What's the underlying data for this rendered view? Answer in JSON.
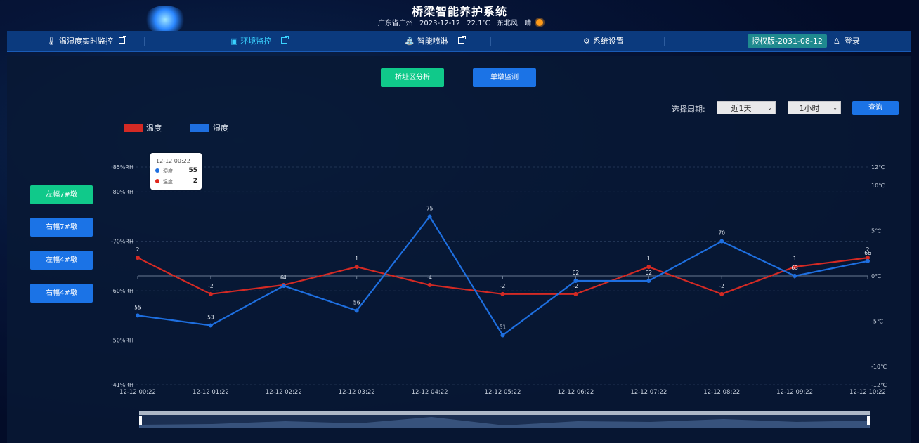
{
  "header": {
    "title": "桥梁智能养护系统",
    "location": "广东省广州",
    "date": "2023-12-12",
    "temperature": "22.1℃",
    "wind": "东北风",
    "weather": "晴",
    "weather_icon": "sun-icon"
  },
  "nav": {
    "items": [
      {
        "label": "温湿度实时监控",
        "icon": "thermometer-icon"
      },
      {
        "label": "环境监控",
        "icon": "monitor-icon",
        "active": true
      },
      {
        "label": "智能喷淋",
        "icon": "sprinkler-icon"
      },
      {
        "label": "系统设置",
        "icon": "gear-icon"
      }
    ],
    "license": "授权版-2031-08-12",
    "login": "登录"
  },
  "top_buttons": {
    "left": "桥址区分析",
    "right": "单墩监测"
  },
  "side_buttons": [
    "左幅7#墩",
    "右幅7#墩",
    "左幅4#墩",
    "右幅4#墩"
  ],
  "filter": {
    "label": "选择周期:",
    "period": "近1天",
    "interval": "1小时",
    "query": "查询"
  },
  "legend": {
    "temperature": "温度",
    "humidity": "湿度"
  },
  "tooltip": {
    "time": "12-12 00:22",
    "rows": [
      {
        "name": "湿度",
        "value": "55",
        "color": "#1e6fe0"
      },
      {
        "name": "温度",
        "value": "2",
        "color": "#e0251b"
      }
    ]
  },
  "colors": {
    "temperature": "#d42a24",
    "humidity": "#1e6fe0",
    "accent_green": "#10c98a",
    "accent_blue": "#1b73e6"
  },
  "chart_data": {
    "type": "line",
    "x": [
      "12-12 00:22",
      "12-12 01:22",
      "12-12 02:22",
      "12-12 03:22",
      "12-12 04:22",
      "12-12 05:22",
      "12-12 06:22",
      "12-12 07:22",
      "12-12 08:22",
      "12-12 09:22",
      "12-12 10:22"
    ],
    "series": [
      {
        "name": "温度",
        "axis": "right",
        "unit": "℃",
        "values": [
          2,
          -2,
          -1,
          1,
          -1,
          -2,
          -2,
          1,
          -2,
          1,
          2
        ]
      },
      {
        "name": "湿度",
        "axis": "left",
        "unit": "%RH",
        "values": [
          55,
          53,
          61,
          56,
          75,
          51,
          62,
          62,
          70,
          63,
          66
        ]
      }
    ],
    "left_axis": {
      "ticks": [
        "85%RH",
        "80%RH",
        "70%RH",
        "60%RH",
        "50%RH",
        "41%RH"
      ],
      "ylim": [
        41,
        85
      ]
    },
    "right_axis": {
      "ticks": [
        "12℃",
        "10℃",
        "5℃",
        "0℃",
        "-5℃",
        "-10℃",
        "-12℃"
      ],
      "ylim": [
        -12,
        12
      ]
    },
    "grid": true,
    "legend_position": "top-left"
  }
}
